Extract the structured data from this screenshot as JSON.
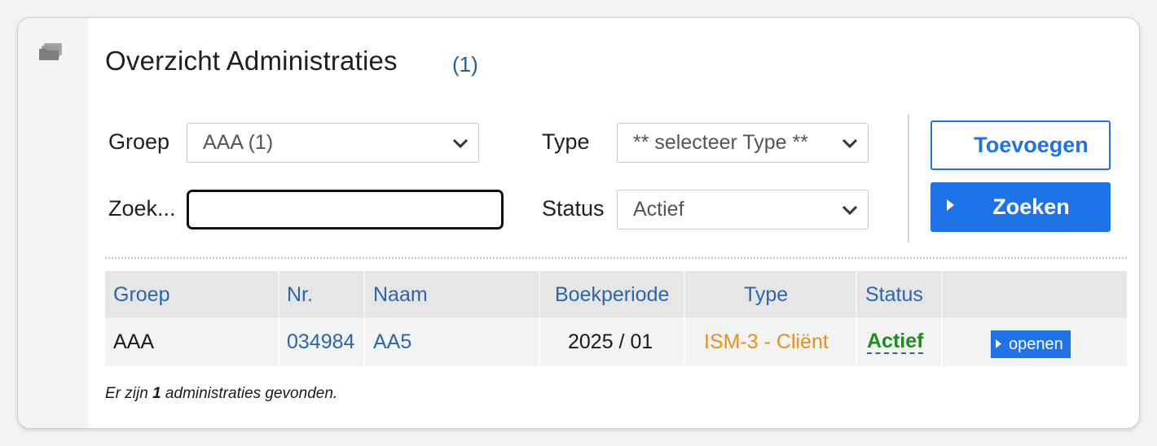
{
  "header": {
    "title": "Overzicht Administraties",
    "count": "(1)"
  },
  "filters": {
    "group_label": "Groep",
    "group_value": "AAA (1)",
    "search_label": "Zoek...",
    "search_value": "",
    "type_label": "Type",
    "type_value": "** selecteer Type **",
    "status_label": "Status",
    "status_value": "Actief"
  },
  "actions": {
    "add_label": "Toevoegen",
    "search_label": "Zoeken"
  },
  "table": {
    "headers": [
      "Groep",
      "Nr.",
      "Naam",
      "Boekperiode",
      "Type",
      "Status"
    ],
    "rows": [
      {
        "groep": "AAA",
        "nr": "034984",
        "naam": "AA5",
        "boekperiode": "2025 / 01",
        "type": "ISM-3 - Cliënt",
        "status": "Actief",
        "open_label": "openen"
      }
    ]
  },
  "footer": {
    "prefix": "Er zijn ",
    "count": "1",
    "suffix": " administraties gevonden."
  },
  "colors": {
    "accent": "#1e73e8",
    "link": "#2a66a8",
    "type_orange": "#e8901a",
    "status_green": "#1f8a1f"
  },
  "icons": {
    "rail": "folders-icon",
    "dropdown": "chevron-down-icon",
    "button_arrow": "caret-right-icon"
  }
}
